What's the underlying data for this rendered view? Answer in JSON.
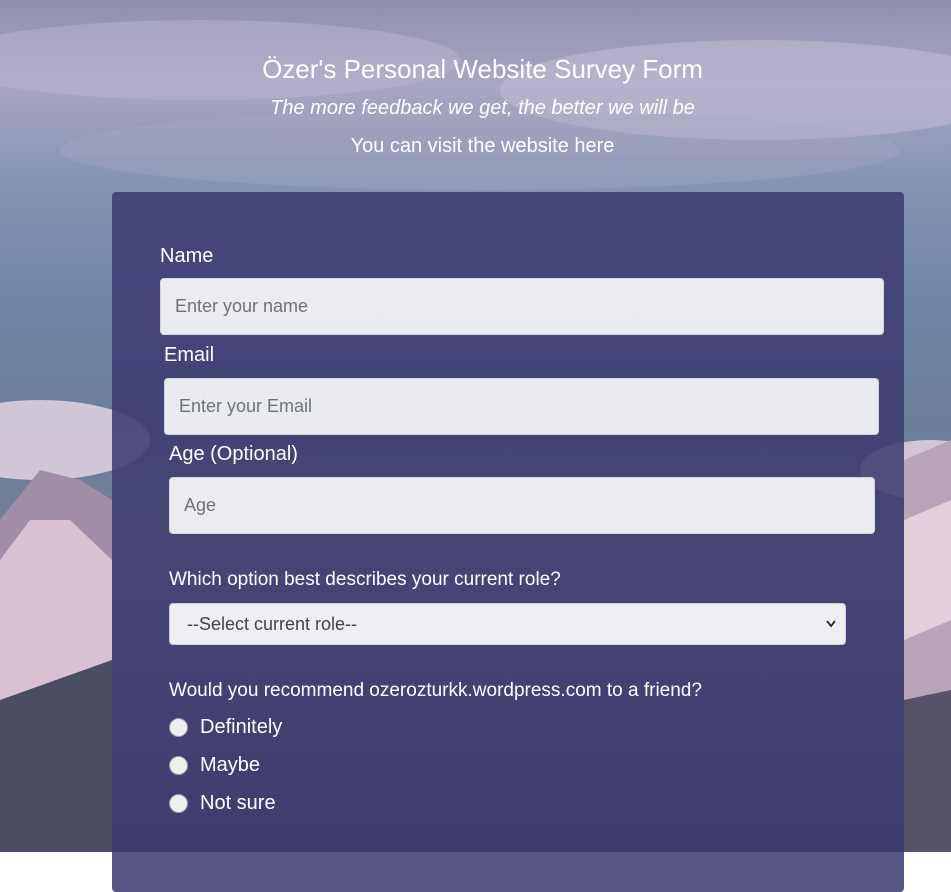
{
  "header": {
    "title": "Özer's Personal Website Survey Form",
    "subtitle": "The more feedback we get, the better we will be",
    "visit_text": "You can visit the website here"
  },
  "form": {
    "name": {
      "label": "Name",
      "placeholder": "Enter your name"
    },
    "email": {
      "label": "Email",
      "placeholder": "Enter your Email"
    },
    "age": {
      "label": "Age (Optional)",
      "placeholder": "Age"
    },
    "role": {
      "question": "Which option best describes your current role?",
      "selected": "--Select current role--"
    },
    "recommend": {
      "question": "Would you recommend ozerozturkk.wordpress.com to a friend?",
      "options": [
        "Definitely",
        "Maybe",
        "Not sure"
      ]
    }
  },
  "icons": {
    "select_arrow": "chevron-down-icon"
  }
}
